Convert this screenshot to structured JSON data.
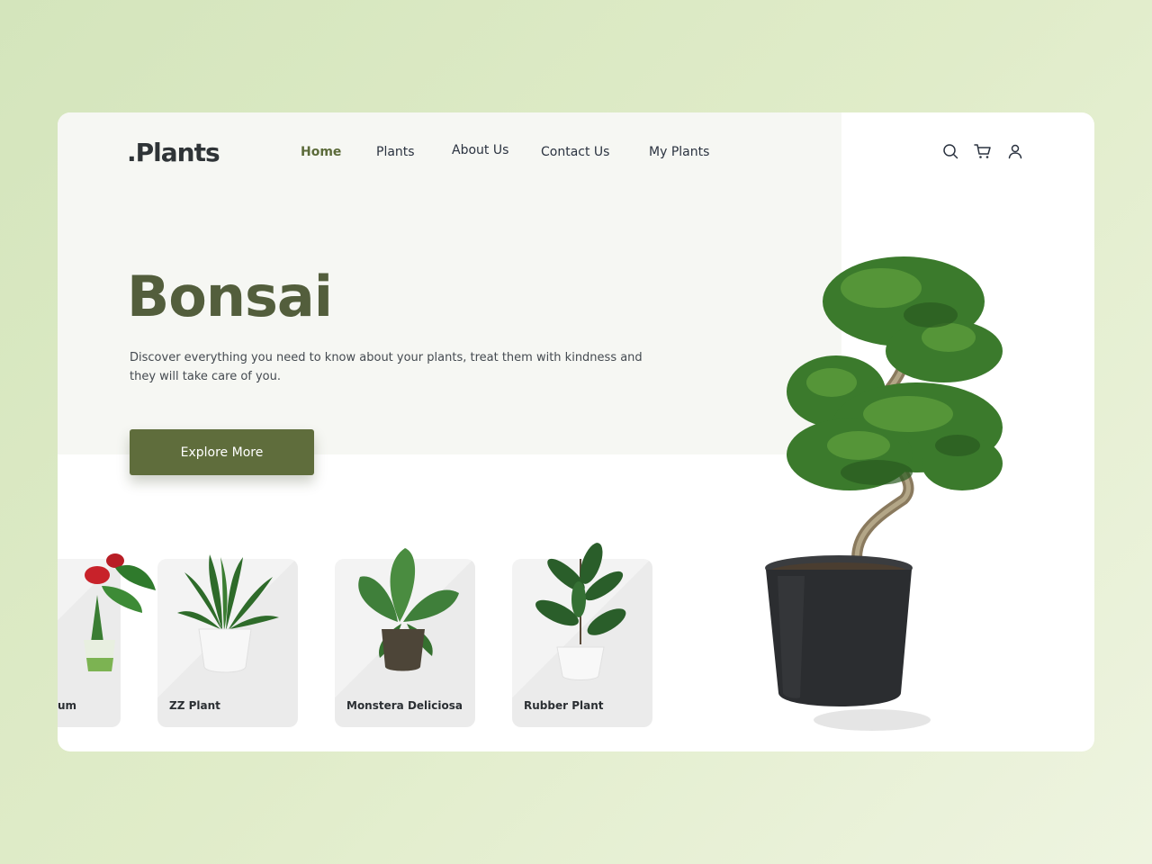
{
  "brand": {
    "logo": ".Plants"
  },
  "nav": {
    "items": [
      {
        "label": "Home",
        "active": true
      },
      {
        "label": "Plants",
        "active": false
      },
      {
        "label": "About Us",
        "active": false
      },
      {
        "label": "Contact Us",
        "active": false
      },
      {
        "label": "My Plants",
        "active": false
      }
    ]
  },
  "header_icons": [
    "search-icon",
    "cart-icon",
    "user-icon"
  ],
  "hero": {
    "title": "Bonsai",
    "description": "Discover everything you need to know about your plants, treat them with kindness and they will take care of you.",
    "cta_label": "Explore More"
  },
  "products": [
    {
      "name": "um"
    },
    {
      "name": "ZZ Plant"
    },
    {
      "name": "Monstera Deliciosa"
    },
    {
      "name": "Rubber Plant"
    }
  ],
  "colors": {
    "accent": "#5f6d3c",
    "title": "#535e3c",
    "active_nav": "#5c6b3a",
    "pot": "#2b2d30",
    "background": "#dbe8c6"
  }
}
